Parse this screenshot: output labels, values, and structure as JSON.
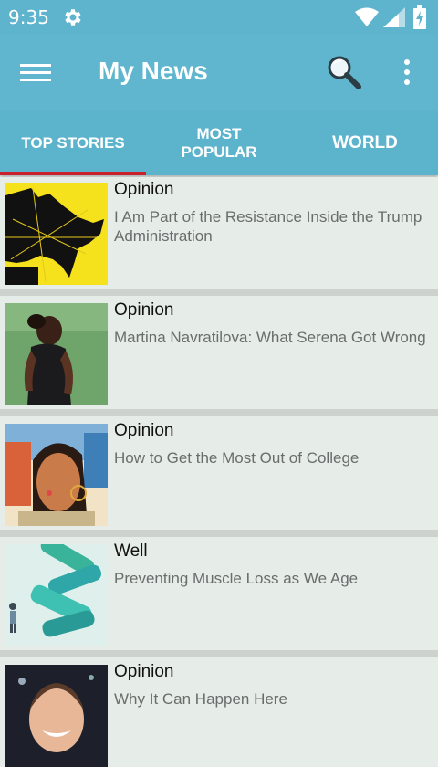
{
  "status_bar": {
    "time": "9:35",
    "icons": [
      "gear-icon",
      "wifi-icon",
      "signal-icon",
      "battery-icon"
    ]
  },
  "app_bar": {
    "title": "My News",
    "icons": [
      "menu-icon",
      "search-icon",
      "more-vert-icon"
    ]
  },
  "tabs": [
    {
      "label": "TOP STORIES",
      "selected": true
    },
    {
      "label": "MOST POPULAR",
      "selected": false
    },
    {
      "label": "WORLD",
      "selected": false
    }
  ],
  "stories": [
    {
      "section": "Opinion",
      "headline": "I Am Part of the Resistance Inside the Trump Administration"
    },
    {
      "section": "Opinion",
      "headline": "Martina Navratilova: What Serena Got Wrong"
    },
    {
      "section": "Opinion",
      "headline": "How to Get the Most Out of College"
    },
    {
      "section": "Well",
      "headline": "Preventing Muscle Loss as We Age"
    },
    {
      "section": "Opinion",
      "headline": "Why It Can Happen Here"
    }
  ],
  "colors": {
    "status_bar": "#5db4cc",
    "app_bar": "#60b6ce",
    "tab_indicator": "#c8202d",
    "list_background": "#e6ece8"
  }
}
